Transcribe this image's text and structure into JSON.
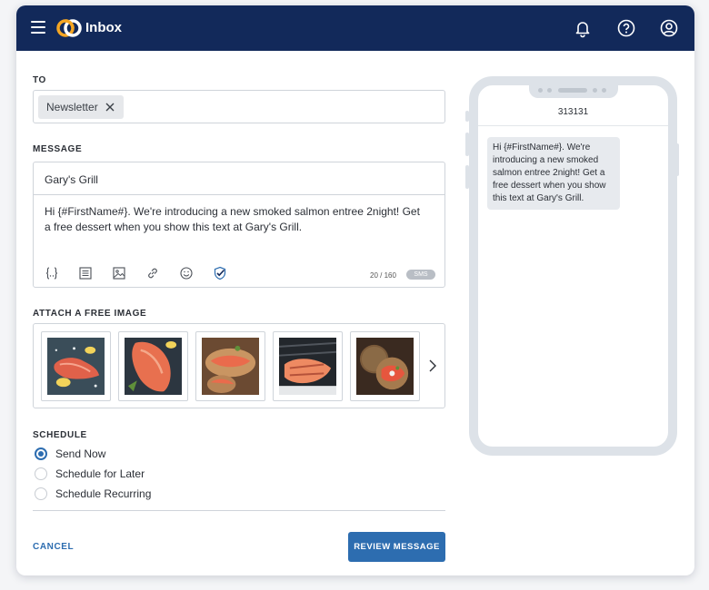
{
  "header": {
    "title": "Inbox",
    "menu_icon": "hamburger-icon",
    "logo_icon": "brand-logo-icon",
    "actions": [
      "bell-icon",
      "help-icon",
      "account-icon"
    ],
    "bg_color": "#12295a"
  },
  "to": {
    "label": "TO",
    "recipients": [
      {
        "label": "Newsletter"
      }
    ]
  },
  "message": {
    "label": "MESSAGE",
    "sender_name": "Gary's Grill",
    "body": "Hi {#FirstName#}. We're introducing a new smoked salmon entree 2night! Get a free dessert when you show this text at Gary's Grill.",
    "toolbar_icons": [
      "merge-field-icon",
      "template-icon",
      "image-icon",
      "link-icon",
      "emoji-icon",
      "verify-icon"
    ],
    "char_count": "20 / 160",
    "type_badge": "SMS"
  },
  "images": {
    "label": "ATTACH A FREE IMAGE",
    "thumbnails": [
      "salmon-1",
      "salmon-2",
      "salmon-3",
      "salmon-4",
      "salmon-5"
    ],
    "next_icon": "chevron-right-icon"
  },
  "schedule": {
    "label": "SCHEDULE",
    "options": [
      {
        "label": "Send Now",
        "selected": true
      },
      {
        "label": "Schedule for Later",
        "selected": false
      },
      {
        "label": "Schedule Recurring",
        "selected": false
      }
    ]
  },
  "footer": {
    "cancel_label": "CANCEL",
    "review_label": "REVIEW MESSAGE",
    "accent": "#2d6db0"
  },
  "preview": {
    "short_code": "313131",
    "bubble_text": "Hi {#FirstName#}. We're introducing a new smoked salmon entree 2night! Get a free dessert when you show this text at Gary's Grill."
  }
}
